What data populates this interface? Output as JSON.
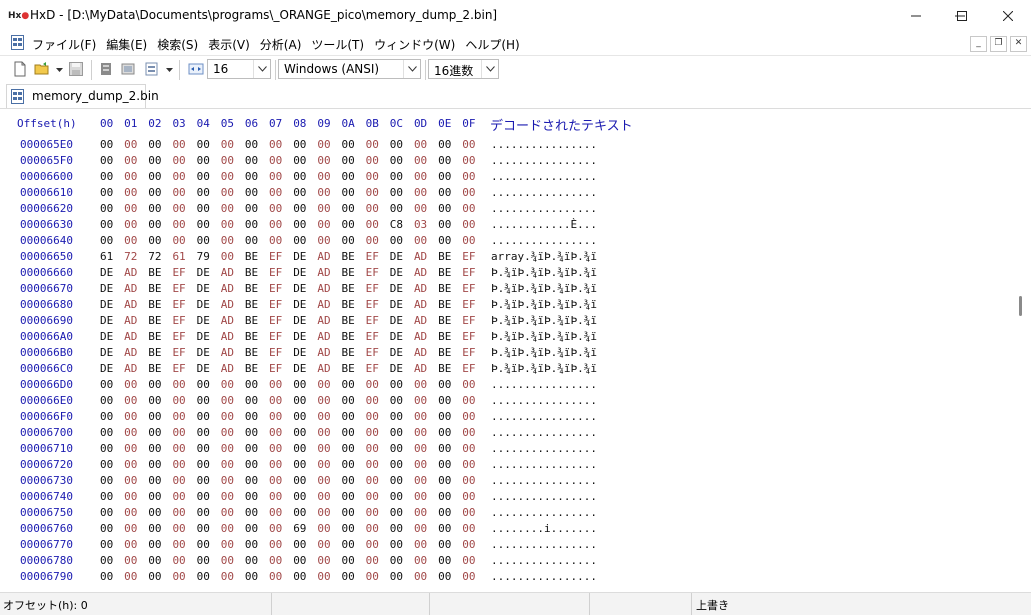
{
  "window": {
    "title": "HxD - [D:\\MyData\\Documents\\programs\\_ORANGE_pico\\memory_dump_2.bin]"
  },
  "menu": {
    "items": [
      "ファイル(F)",
      "編集(E)",
      "検索(S)",
      "表示(V)",
      "分析(A)",
      "ツール(T)",
      "ウィンドウ(W)",
      "ヘルプ(H)"
    ]
  },
  "toolbar": {
    "bytes_per_row": "16",
    "encoding": "Windows (ANSI)",
    "offset_base": "16進数"
  },
  "tab": {
    "label": "memory_dump_2.bin"
  },
  "hex": {
    "offset_header": "Offset(h)",
    "columns": [
      "00",
      "01",
      "02",
      "03",
      "04",
      "05",
      "06",
      "07",
      "08",
      "09",
      "0A",
      "0B",
      "0C",
      "0D",
      "0E",
      "0F"
    ],
    "decoded_header": "デコードされたテキスト",
    "rows": [
      {
        "offset": "000065E0",
        "bytes": [
          "00",
          "00",
          "00",
          "00",
          "00",
          "00",
          "00",
          "00",
          "00",
          "00",
          "00",
          "00",
          "00",
          "00",
          "00",
          "00"
        ],
        "text": "................"
      },
      {
        "offset": "000065F0",
        "bytes": [
          "00",
          "00",
          "00",
          "00",
          "00",
          "00",
          "00",
          "00",
          "00",
          "00",
          "00",
          "00",
          "00",
          "00",
          "00",
          "00"
        ],
        "text": "................"
      },
      {
        "offset": "00006600",
        "bytes": [
          "00",
          "00",
          "00",
          "00",
          "00",
          "00",
          "00",
          "00",
          "00",
          "00",
          "00",
          "00",
          "00",
          "00",
          "00",
          "00"
        ],
        "text": "................"
      },
      {
        "offset": "00006610",
        "bytes": [
          "00",
          "00",
          "00",
          "00",
          "00",
          "00",
          "00",
          "00",
          "00",
          "00",
          "00",
          "00",
          "00",
          "00",
          "00",
          "00"
        ],
        "text": "................"
      },
      {
        "offset": "00006620",
        "bytes": [
          "00",
          "00",
          "00",
          "00",
          "00",
          "00",
          "00",
          "00",
          "00",
          "00",
          "00",
          "00",
          "00",
          "00",
          "00",
          "00"
        ],
        "text": "................"
      },
      {
        "offset": "00006630",
        "bytes": [
          "00",
          "00",
          "00",
          "00",
          "00",
          "00",
          "00",
          "00",
          "00",
          "00",
          "00",
          "00",
          "C8",
          "03",
          "00",
          "00"
        ],
        "text": "............È..."
      },
      {
        "offset": "00006640",
        "bytes": [
          "00",
          "00",
          "00",
          "00",
          "00",
          "00",
          "00",
          "00",
          "00",
          "00",
          "00",
          "00",
          "00",
          "00",
          "00",
          "00"
        ],
        "text": "................"
      },
      {
        "offset": "00006650",
        "bytes": [
          "61",
          "72",
          "72",
          "61",
          "79",
          "00",
          "BE",
          "EF",
          "DE",
          "AD",
          "BE",
          "EF",
          "DE",
          "AD",
          "BE",
          "EF"
        ],
        "text": "array.¾ïÞ.¾ïÞ.¾ï"
      },
      {
        "offset": "00006660",
        "bytes": [
          "DE",
          "AD",
          "BE",
          "EF",
          "DE",
          "AD",
          "BE",
          "EF",
          "DE",
          "AD",
          "BE",
          "EF",
          "DE",
          "AD",
          "BE",
          "EF"
        ],
        "text": "Þ.¾ïÞ.¾ïÞ.¾ïÞ.¾ï"
      },
      {
        "offset": "00006670",
        "bytes": [
          "DE",
          "AD",
          "BE",
          "EF",
          "DE",
          "AD",
          "BE",
          "EF",
          "DE",
          "AD",
          "BE",
          "EF",
          "DE",
          "AD",
          "BE",
          "EF"
        ],
        "text": "Þ.¾ïÞ.¾ïÞ.¾ïÞ.¾ï"
      },
      {
        "offset": "00006680",
        "bytes": [
          "DE",
          "AD",
          "BE",
          "EF",
          "DE",
          "AD",
          "BE",
          "EF",
          "DE",
          "AD",
          "BE",
          "EF",
          "DE",
          "AD",
          "BE",
          "EF"
        ],
        "text": "Þ.¾ïÞ.¾ïÞ.¾ïÞ.¾ï"
      },
      {
        "offset": "00006690",
        "bytes": [
          "DE",
          "AD",
          "BE",
          "EF",
          "DE",
          "AD",
          "BE",
          "EF",
          "DE",
          "AD",
          "BE",
          "EF",
          "DE",
          "AD",
          "BE",
          "EF"
        ],
        "text": "Þ.¾ïÞ.¾ïÞ.¾ïÞ.¾ï"
      },
      {
        "offset": "000066A0",
        "bytes": [
          "DE",
          "AD",
          "BE",
          "EF",
          "DE",
          "AD",
          "BE",
          "EF",
          "DE",
          "AD",
          "BE",
          "EF",
          "DE",
          "AD",
          "BE",
          "EF"
        ],
        "text": "Þ.¾ïÞ.¾ïÞ.¾ïÞ.¾ï"
      },
      {
        "offset": "000066B0",
        "bytes": [
          "DE",
          "AD",
          "BE",
          "EF",
          "DE",
          "AD",
          "BE",
          "EF",
          "DE",
          "AD",
          "BE",
          "EF",
          "DE",
          "AD",
          "BE",
          "EF"
        ],
        "text": "Þ.¾ïÞ.¾ïÞ.¾ïÞ.¾ï"
      },
      {
        "offset": "000066C0",
        "bytes": [
          "DE",
          "AD",
          "BE",
          "EF",
          "DE",
          "AD",
          "BE",
          "EF",
          "DE",
          "AD",
          "BE",
          "EF",
          "DE",
          "AD",
          "BE",
          "EF"
        ],
        "text": "Þ.¾ïÞ.¾ïÞ.¾ïÞ.¾ï"
      },
      {
        "offset": "000066D0",
        "bytes": [
          "00",
          "00",
          "00",
          "00",
          "00",
          "00",
          "00",
          "00",
          "00",
          "00",
          "00",
          "00",
          "00",
          "00",
          "00",
          "00"
        ],
        "text": "................"
      },
      {
        "offset": "000066E0",
        "bytes": [
          "00",
          "00",
          "00",
          "00",
          "00",
          "00",
          "00",
          "00",
          "00",
          "00",
          "00",
          "00",
          "00",
          "00",
          "00",
          "00"
        ],
        "text": "................"
      },
      {
        "offset": "000066F0",
        "bytes": [
          "00",
          "00",
          "00",
          "00",
          "00",
          "00",
          "00",
          "00",
          "00",
          "00",
          "00",
          "00",
          "00",
          "00",
          "00",
          "00"
        ],
        "text": "................"
      },
      {
        "offset": "00006700",
        "bytes": [
          "00",
          "00",
          "00",
          "00",
          "00",
          "00",
          "00",
          "00",
          "00",
          "00",
          "00",
          "00",
          "00",
          "00",
          "00",
          "00"
        ],
        "text": "................"
      },
      {
        "offset": "00006710",
        "bytes": [
          "00",
          "00",
          "00",
          "00",
          "00",
          "00",
          "00",
          "00",
          "00",
          "00",
          "00",
          "00",
          "00",
          "00",
          "00",
          "00"
        ],
        "text": "................"
      },
      {
        "offset": "00006720",
        "bytes": [
          "00",
          "00",
          "00",
          "00",
          "00",
          "00",
          "00",
          "00",
          "00",
          "00",
          "00",
          "00",
          "00",
          "00",
          "00",
          "00"
        ],
        "text": "................"
      },
      {
        "offset": "00006730",
        "bytes": [
          "00",
          "00",
          "00",
          "00",
          "00",
          "00",
          "00",
          "00",
          "00",
          "00",
          "00",
          "00",
          "00",
          "00",
          "00",
          "00"
        ],
        "text": "................"
      },
      {
        "offset": "00006740",
        "bytes": [
          "00",
          "00",
          "00",
          "00",
          "00",
          "00",
          "00",
          "00",
          "00",
          "00",
          "00",
          "00",
          "00",
          "00",
          "00",
          "00"
        ],
        "text": "................"
      },
      {
        "offset": "00006750",
        "bytes": [
          "00",
          "00",
          "00",
          "00",
          "00",
          "00",
          "00",
          "00",
          "00",
          "00",
          "00",
          "00",
          "00",
          "00",
          "00",
          "00"
        ],
        "text": "................"
      },
      {
        "offset": "00006760",
        "bytes": [
          "00",
          "00",
          "00",
          "00",
          "00",
          "00",
          "00",
          "00",
          "69",
          "00",
          "00",
          "00",
          "00",
          "00",
          "00",
          "00"
        ],
        "text": "........i......."
      },
      {
        "offset": "00006770",
        "bytes": [
          "00",
          "00",
          "00",
          "00",
          "00",
          "00",
          "00",
          "00",
          "00",
          "00",
          "00",
          "00",
          "00",
          "00",
          "00",
          "00"
        ],
        "text": "................"
      },
      {
        "offset": "00006780",
        "bytes": [
          "00",
          "00",
          "00",
          "00",
          "00",
          "00",
          "00",
          "00",
          "00",
          "00",
          "00",
          "00",
          "00",
          "00",
          "00",
          "00"
        ],
        "text": "................"
      },
      {
        "offset": "00006790",
        "bytes": [
          "00",
          "00",
          "00",
          "00",
          "00",
          "00",
          "00",
          "00",
          "00",
          "00",
          "00",
          "00",
          "00",
          "00",
          "00",
          "00"
        ],
        "text": "................"
      }
    ]
  },
  "status": {
    "offset": "オフセット(h): 0",
    "mode": "上書き"
  }
}
